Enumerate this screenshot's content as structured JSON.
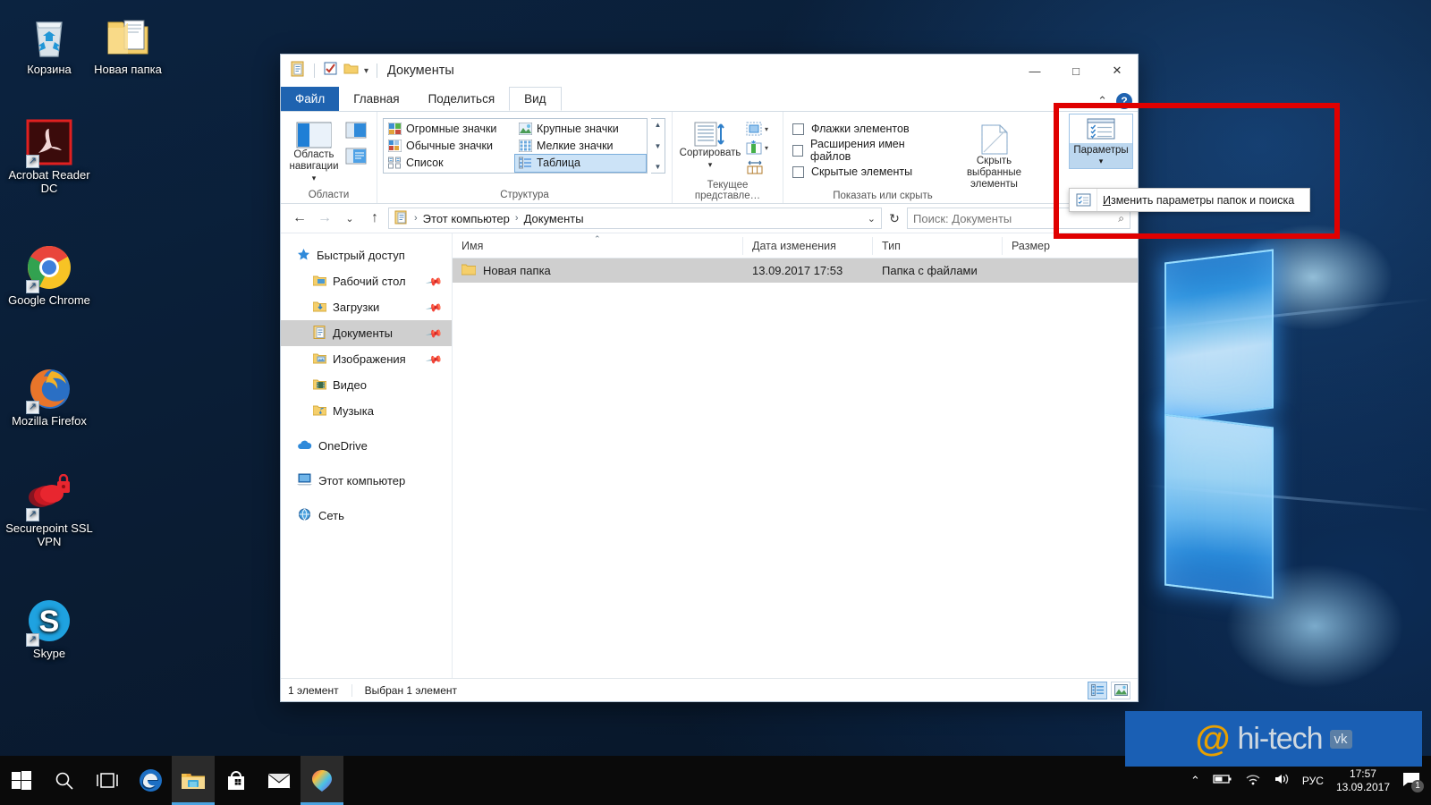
{
  "desktop": {
    "icons": [
      {
        "name": "Корзина",
        "icon": "recycle-bin-icon"
      },
      {
        "name": "Новая папка",
        "icon": "folder-icon"
      },
      {
        "name": "Acrobat Reader DC",
        "icon": "acrobat-reader-icon"
      },
      {
        "name": "Google Chrome",
        "icon": "chrome-icon"
      },
      {
        "name": "Mozilla Firefox",
        "icon": "firefox-icon"
      },
      {
        "name": "Securepoint SSL VPN",
        "icon": "securepoint-vpn-icon"
      },
      {
        "name": "Skype",
        "icon": "skype-icon"
      }
    ]
  },
  "window": {
    "title": "Документы",
    "quick_access": [
      "properties-icon",
      "new-folder-icon",
      "customize-dropdown-icon"
    ],
    "controls": {
      "minimize": "—",
      "maximize": "□",
      "close": "✕"
    },
    "tabs": [
      {
        "label": "Файл",
        "state": "file"
      },
      {
        "label": "Главная",
        "state": "normal"
      },
      {
        "label": "Поделиться",
        "state": "normal"
      },
      {
        "label": "Вид",
        "state": "active"
      }
    ],
    "help_label": "?",
    "collapse_ribbon_label": "⌃"
  },
  "ribbon": {
    "groups": [
      {
        "title": "Области"
      },
      {
        "title": "Структура"
      },
      {
        "title": "Текущее представле…"
      },
      {
        "title": "Показать или скрыть"
      }
    ],
    "nav_pane_button": {
      "line1": "Область",
      "line2": "навигации",
      "caret": "▾"
    },
    "layout_options": [
      {
        "label": "Огромные значки",
        "selected": false
      },
      {
        "label": "Крупные значки",
        "selected": false
      },
      {
        "label": "Обычные значки",
        "selected": false
      },
      {
        "label": "Мелкие значки",
        "selected": false
      },
      {
        "label": "Список",
        "selected": false
      },
      {
        "label": "Таблица",
        "selected": true
      }
    ],
    "sort_button": {
      "label": "Сортировать",
      "caret": "▾"
    },
    "checkboxes": [
      {
        "label": "Флажки элементов",
        "checked": false
      },
      {
        "label": "Расширения имен файлов",
        "checked": false
      },
      {
        "label": "Скрытые элементы",
        "checked": false
      }
    ],
    "hide_selected": {
      "line1": "Скрыть выбранные",
      "line2": "элементы"
    },
    "options_button": {
      "label": "Параметры",
      "caret": "▾"
    },
    "options_menu_item": {
      "prefix": "И",
      "rest": "зменить параметры папок и поиска"
    }
  },
  "address": {
    "back": "←",
    "forward": "→",
    "history": "⌄",
    "up": "↑",
    "crumbs": [
      "Этот компьютер",
      "Документы"
    ],
    "crumb_separator": "›",
    "dropdown": "⌄",
    "refresh": "↻",
    "search_placeholder": "Поиск: Документы",
    "search_icon": "search-icon"
  },
  "nav_pane": {
    "items": [
      {
        "label": "Быстрый доступ",
        "icon": "star-icon",
        "indent": false,
        "pinned": false,
        "selected": false
      },
      {
        "label": "Рабочий стол",
        "icon": "desktop-folder-icon",
        "indent": true,
        "pinned": true,
        "selected": false
      },
      {
        "label": "Загрузки",
        "icon": "downloads-folder-icon",
        "indent": true,
        "pinned": true,
        "selected": false
      },
      {
        "label": "Документы",
        "icon": "documents-folder-icon",
        "indent": true,
        "pinned": true,
        "selected": true
      },
      {
        "label": "Изображения",
        "icon": "pictures-folder-icon",
        "indent": true,
        "pinned": true,
        "selected": false
      },
      {
        "label": "Видео",
        "icon": "videos-folder-icon",
        "indent": true,
        "pinned": false,
        "selected": false
      },
      {
        "label": "Музыка",
        "icon": "music-folder-icon",
        "indent": true,
        "pinned": false,
        "selected": false
      },
      {
        "label": "OneDrive",
        "icon": "onedrive-icon",
        "indent": false,
        "pinned": false,
        "selected": false
      },
      {
        "label": "Этот компьютер",
        "icon": "this-pc-icon",
        "indent": false,
        "pinned": false,
        "selected": false
      },
      {
        "label": "Сеть",
        "icon": "network-icon",
        "indent": false,
        "pinned": false,
        "selected": false
      }
    ]
  },
  "file_list": {
    "columns": [
      "Имя",
      "Дата изменения",
      "Тип",
      "Размер"
    ],
    "sort_indicator": "⌃",
    "rows": [
      {
        "name": "Новая папка",
        "modified": "13.09.2017 17:53",
        "type": "Папка с файлами",
        "size": "",
        "icon": "folder-icon",
        "selected": true
      }
    ]
  },
  "status_bar": {
    "count": "1 элемент",
    "selection": "Выбран 1 элемент",
    "view_details": "details-view-icon",
    "view_large": "large-icons-view-icon"
  },
  "taskbar": {
    "buttons": [
      {
        "icon": "windows-start-icon",
        "name": "start-button",
        "open": false
      },
      {
        "icon": "search-icon",
        "name": "search-button",
        "open": false
      },
      {
        "icon": "task-view-icon",
        "name": "task-view-button",
        "open": false
      },
      {
        "icon": "edge-icon",
        "name": "edge-button",
        "open": false
      },
      {
        "icon": "file-explorer-icon",
        "name": "file-explorer-button",
        "open": true
      },
      {
        "icon": "store-icon",
        "name": "store-button",
        "open": false
      },
      {
        "icon": "mail-icon",
        "name": "mail-button",
        "open": false
      },
      {
        "icon": "paint3d-icon",
        "name": "paint3d-button",
        "open": true
      }
    ],
    "tray": {
      "chevron": "⌃",
      "battery": "battery-icon",
      "wifi": "wifi-icon",
      "volume": "volume-icon",
      "language": "РУС",
      "time": "17:57",
      "date": "13.09.2017",
      "notifications": "notification-icon",
      "notification_count": "1"
    }
  },
  "watermark": {
    "at": "@",
    "text": "hi-tech",
    "vk": "vk"
  },
  "colors": {
    "accent": "#1f63b0",
    "highlight_box": "#e00000",
    "selection": "#cce3f7",
    "row_selection": "#cfcfcf",
    "taskbar": "#0a0a0a"
  }
}
